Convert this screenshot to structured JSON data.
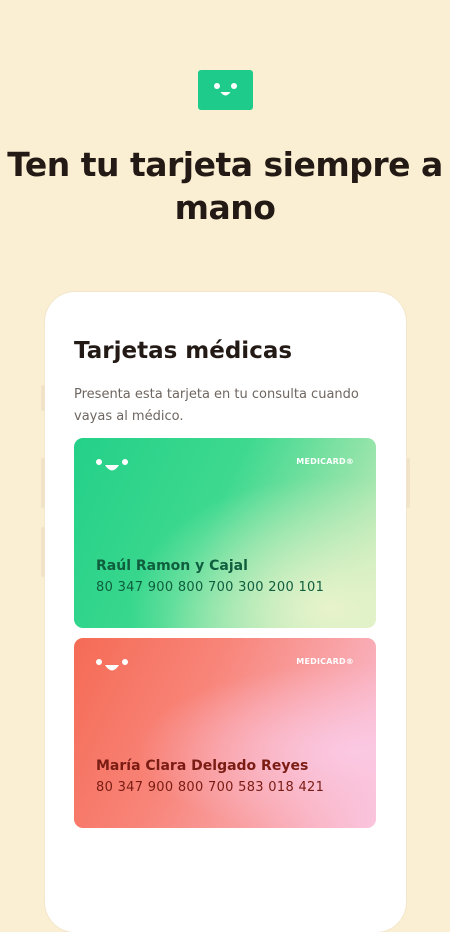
{
  "brand": {
    "logo_icon": "smiley-logo-icon",
    "accent": "#1FCB8A"
  },
  "hero": {
    "title": "Ten tu tarjeta siempre a mano"
  },
  "phone": {
    "title": "Tarjetas médicas",
    "description": "Presenta esta tarjeta en tu consulta cuando vayas al médico."
  },
  "cards": [
    {
      "brand": "MEDICARD®",
      "name": "Raúl Ramon y Cajal",
      "number": "80 347 900 800 700 300 200 101",
      "color": "green"
    },
    {
      "brand": "MEDICARD®",
      "name": "María Clara Delgado Reyes",
      "number": "80 347 900 800 700 583 018 421",
      "color": "coral"
    }
  ],
  "colors": {
    "background": "#FBEFD3",
    "text": "#231A15",
    "card_green": "#24D088",
    "card_coral": "#F56B55"
  }
}
